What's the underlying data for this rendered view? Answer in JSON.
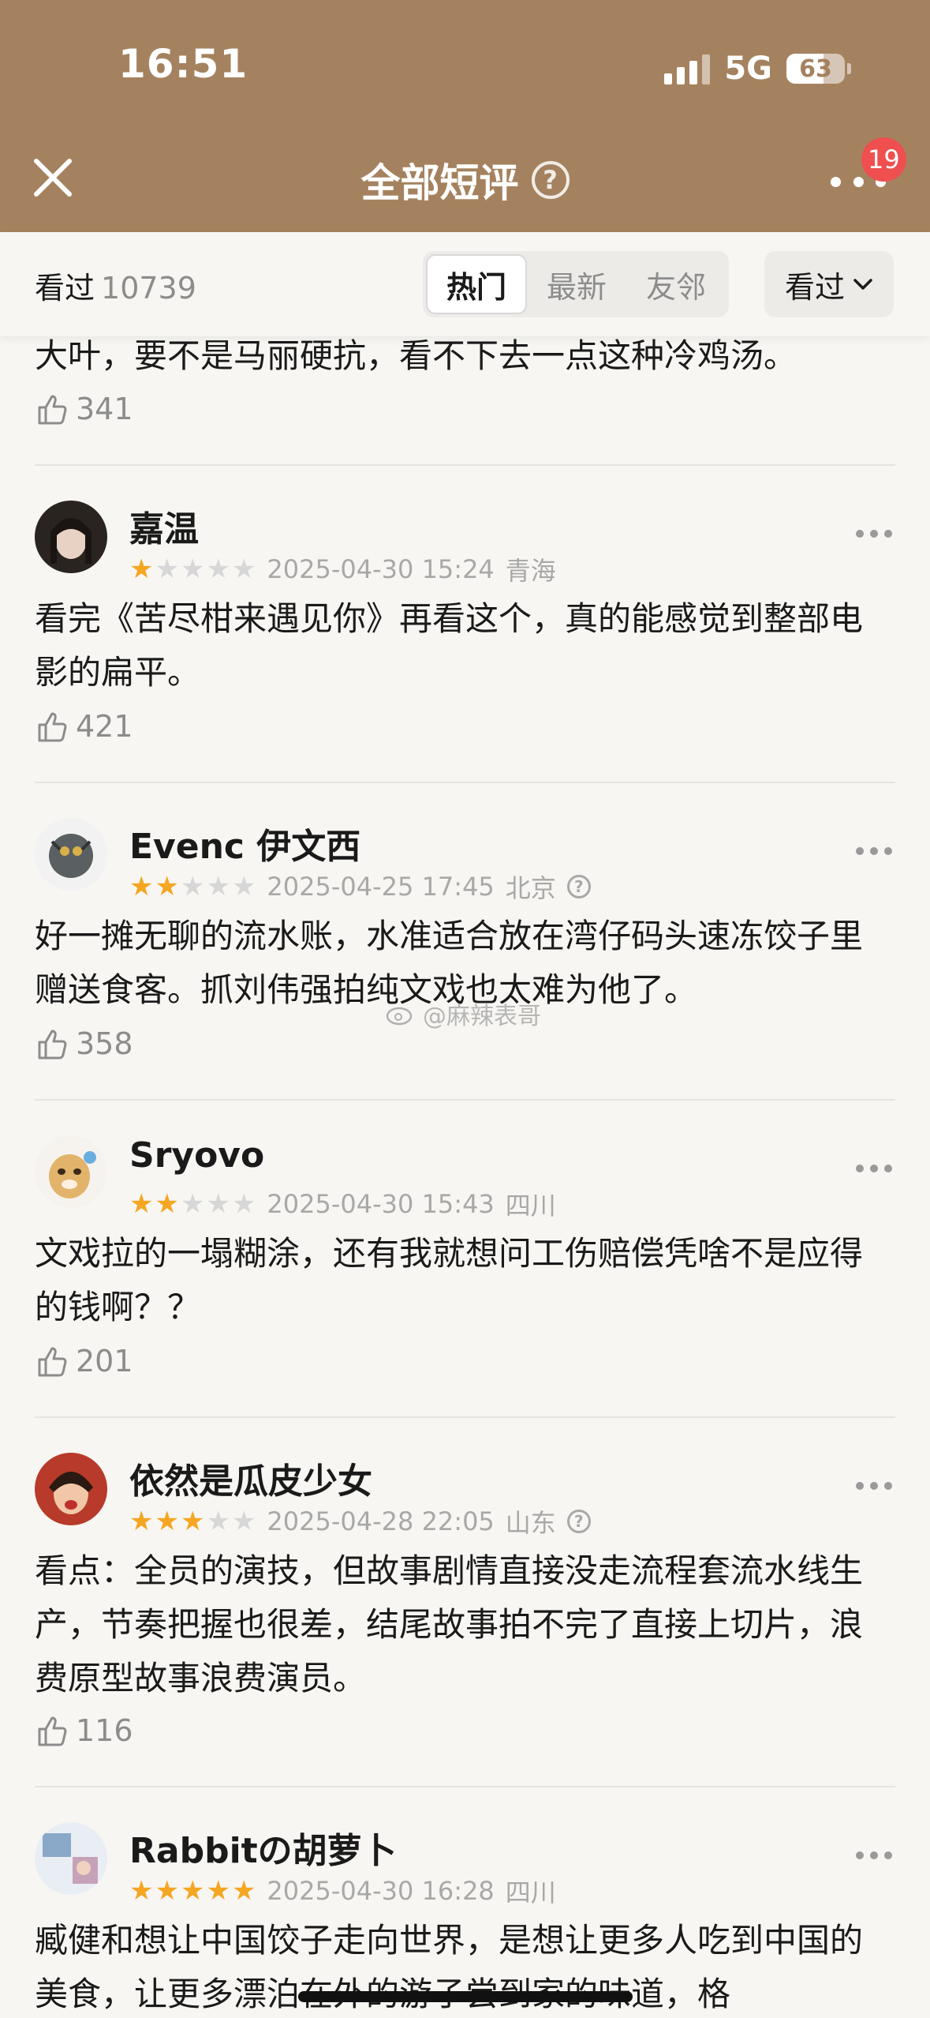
{
  "status_bar": {
    "time": "16:51",
    "network": "5G",
    "battery": 63
  },
  "nav": {
    "title": "全部短评",
    "help_glyph": "?",
    "badge_count": "19"
  },
  "filter": {
    "watched_label": "看过",
    "watched_count": "10739",
    "tabs": [
      {
        "label": "热门",
        "active": true
      },
      {
        "label": "最新"
      },
      {
        "label": "友邻"
      }
    ],
    "dropdown_label": "看过"
  },
  "partial_comment": {
    "text": "大叶，要不是马丽硬抗，看不下去一点这种冷鸡汤。",
    "likes": "341"
  },
  "comments": [
    {
      "user": "嘉温",
      "rating": 1,
      "date": "2025-04-30 15:24",
      "location": "青海",
      "text": "看完《苦尽柑来遇见你》再看这个，真的能感觉到整部电影的扁平。",
      "likes": "421"
    },
    {
      "user": "Evenc 伊文西",
      "rating": 2,
      "date": "2025-04-25 17:45",
      "location": "北京",
      "text": "好一摊无聊的流水账，水准适合放在湾仔码头速冻饺子里赠送食客。抓刘伟强拍纯文戏也太难为他了。",
      "likes": "358"
    },
    {
      "user": "Sryovo",
      "rating": 2,
      "date": "2025-04-30 15:43",
      "location": "四川",
      "text": "文戏拉的一塌糊涂，还有我就想问工伤赔偿凭啥不是应得的钱啊？？",
      "likes": "201"
    },
    {
      "user": "依然是瓜皮少女",
      "rating": 3,
      "date": "2025-04-28 22:05",
      "location": "山东",
      "text": "看点：全员的演技，但故事剧情直接没走流程套流水线生产，节奏把握也很差，结尾故事拍不完了直接上切片，浪费原型故事浪费演员。",
      "likes": "116"
    },
    {
      "user": "Rabbitの胡萝卜",
      "rating": 5,
      "date": "2025-04-30 16:28",
      "location": "四川",
      "text": "臧健和想让中国饺子走向世界，是想让更多人吃到中国的美食，让更多漂泊在外的游子尝到家的味道，格",
      "likes": ""
    }
  ],
  "watermark": "@麻辣表哥",
  "colors": {
    "header_bg": "#a5825f",
    "star_on": "#f5a623",
    "star_off": "#d7d7d7",
    "badge": "#ef4f4f"
  }
}
